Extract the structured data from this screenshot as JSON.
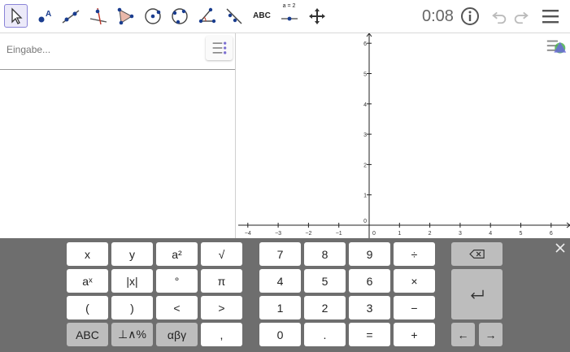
{
  "toolbar": {
    "tools": [
      {
        "icon": "move-arrow-icon",
        "selected": true
      },
      {
        "icon": "point-icon"
      },
      {
        "icon": "line-icon"
      },
      {
        "icon": "perpendicular-line-icon"
      },
      {
        "icon": "polygon-icon"
      },
      {
        "icon": "circle-center-point-icon"
      },
      {
        "icon": "circle-three-points-icon"
      },
      {
        "icon": "angle-icon"
      },
      {
        "icon": "reflect-line-icon"
      },
      {
        "icon": "text-icon",
        "label": "ABC"
      },
      {
        "icon": "slider-icon",
        "label": "a = 2"
      },
      {
        "icon": "move-graphics-icon"
      }
    ],
    "timer": "0:08",
    "accent": "#8a84d8"
  },
  "algebra": {
    "input_placeholder": "Eingabe..."
  },
  "graphics": {
    "x_ticks": [
      "−4",
      "−3",
      "−2",
      "−1",
      "0",
      "1",
      "2",
      "3",
      "4",
      "5",
      "6"
    ],
    "y_ticks": [
      "6",
      "5",
      "4",
      "3",
      "2",
      "1",
      "0"
    ]
  },
  "keyboard": {
    "math_rows": [
      [
        {
          "label": "x"
        },
        {
          "label": "y"
        },
        {
          "label": "a²"
        },
        {
          "label": "√"
        }
      ],
      [
        {
          "label": "aˣ"
        },
        {
          "label": "|x|"
        },
        {
          "label": "°"
        },
        {
          "label": "π"
        }
      ],
      [
        {
          "label": "("
        },
        {
          "label": ")"
        },
        {
          "label": "<"
        },
        {
          "label": ">"
        }
      ],
      [
        {
          "label": "ABC",
          "gray": true
        },
        {
          "label": "⊥∧%",
          "gray": true
        },
        {
          "label": "αβγ",
          "gray": true
        },
        {
          "label": ","
        }
      ]
    ],
    "num_rows": [
      [
        {
          "label": "7"
        },
        {
          "label": "8"
        },
        {
          "label": "9"
        },
        {
          "label": "÷"
        }
      ],
      [
        {
          "label": "4"
        },
        {
          "label": "5"
        },
        {
          "label": "6"
        },
        {
          "label": "×"
        }
      ],
      [
        {
          "label": "1"
        },
        {
          "label": "2"
        },
        {
          "label": "3"
        },
        {
          "label": "−"
        }
      ],
      [
        {
          "label": "0"
        },
        {
          "label": "."
        },
        {
          "label": "="
        },
        {
          "label": "+"
        }
      ]
    ],
    "backspace_icon": "backspace-icon",
    "enter_icon": "enter-icon",
    "left_label": "←",
    "right_label": "→"
  }
}
